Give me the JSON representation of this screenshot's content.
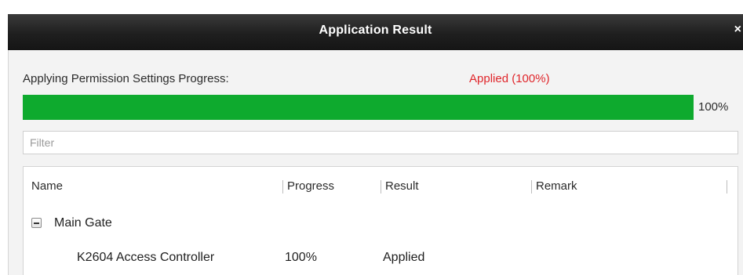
{
  "dialog": {
    "title": "Application Result",
    "close_glyph": "×",
    "progress_label": "Applying Permission Settings Progress:",
    "status_text": "Applied (100%)",
    "progress_value": 100,
    "progress_percent_label": "100%",
    "filter_placeholder": "Filter",
    "colors": {
      "status": "#e0262b",
      "progress_fill": "#0eaa2e",
      "titlebar": "#1f1f1f"
    }
  },
  "table": {
    "columns": [
      "Name",
      "Progress",
      "Result",
      "Remark"
    ],
    "groups": [
      {
        "name": "Main Gate",
        "expanded": true,
        "rows": [
          {
            "name": "K2604 Access Controller",
            "progress": "100%",
            "result": "Applied",
            "remark": ""
          }
        ]
      }
    ]
  },
  "icons": {
    "close": "close-icon",
    "collapse": "collapse-toggle-icon"
  }
}
